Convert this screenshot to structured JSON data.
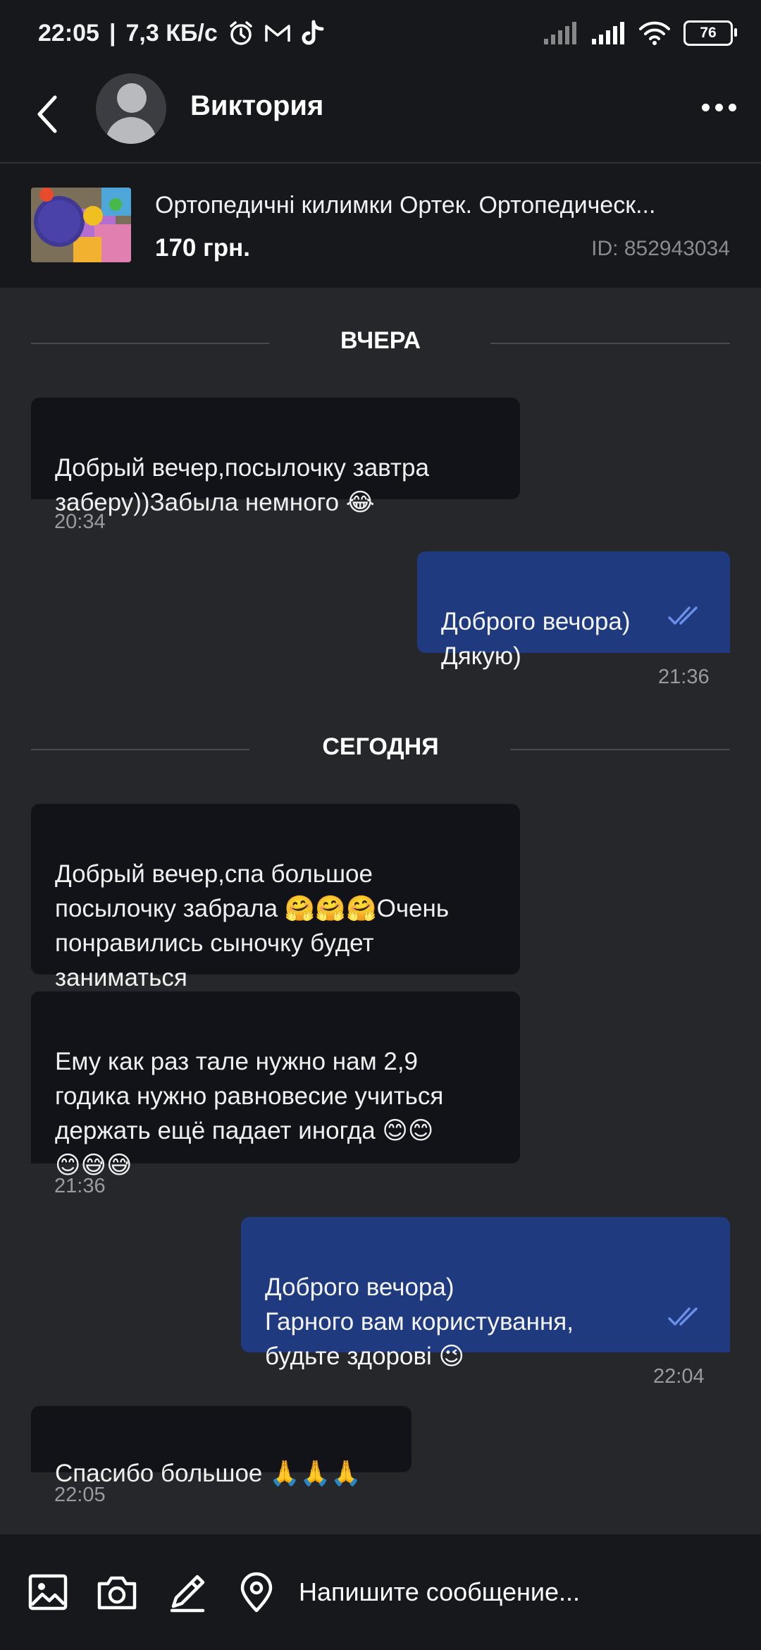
{
  "status_bar": {
    "time": "22:05",
    "separator": "|",
    "speed": "7,3 КБ/с",
    "battery": "76"
  },
  "header": {
    "contact_name": "Виктория"
  },
  "product": {
    "title": "Ортопедичні килимки Ортек. Ортопедическ...",
    "price": "170 грн.",
    "id": "ID: 852943034"
  },
  "chat": {
    "date_yesterday": "ВЧЕРА",
    "date_today": "СЕГОДНЯ",
    "messages": [
      {
        "direction": "in",
        "text": "Добрый вечер,посылочку завтра\nзаберу))Забыла немного 😂",
        "time": "20:34"
      },
      {
        "direction": "out",
        "text": "Доброго вечора)\nДякую)",
        "time": "21:36"
      },
      {
        "direction": "in",
        "text": "Добрый вечер,спа большое\nпосылочку забрала 🤗🤗🤗Очень\nпонравились сыночку будет\nзаниматься",
        "time": ""
      },
      {
        "direction": "in",
        "text": "Ему как раз тале нужно нам 2,9\nгодика нужно равновесие учиться\nдержать ещё падает иногда 😊😊\n😊😅😅",
        "time": "21:36"
      },
      {
        "direction": "out",
        "text": "Доброго вечора)\nГарного вам користування,\nбудьте здорові 😉",
        "time": "22:04"
      },
      {
        "direction": "in",
        "text": "Спасибо большое 🙏🙏🙏",
        "time": "22:05"
      }
    ]
  },
  "input": {
    "placeholder": "Напишите сообщение..."
  },
  "colors": {
    "background": "#26272b",
    "bar": "#17181c",
    "incoming_bubble": "#121318",
    "outgoing_bubble": "#203a80",
    "read_ticks": "#6a8fe8"
  },
  "icons": [
    "back-arrow-icon",
    "avatar-placeholder-icon",
    "more-icon",
    "double-check-icon",
    "gallery-icon",
    "camera-icon",
    "attach-icon",
    "location-icon"
  ]
}
